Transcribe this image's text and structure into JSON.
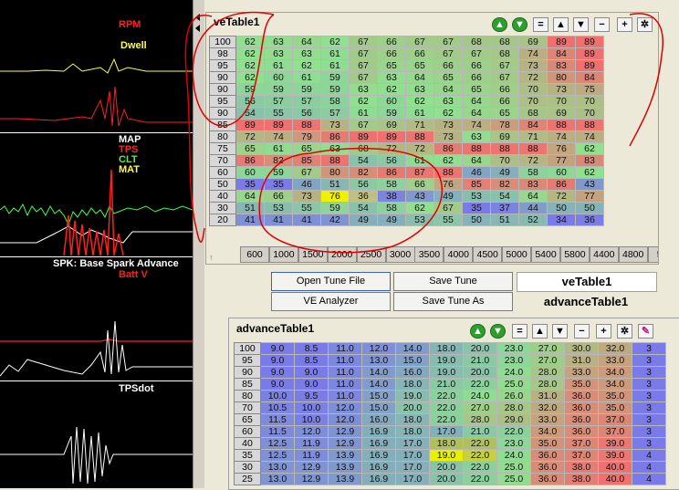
{
  "gauges": {
    "rpm": "RPM",
    "dwell": "Dwell",
    "map": "MAP",
    "tps": "TPS",
    "clt": "CLT",
    "mat": "MAT",
    "spk": "SPK: Base Spark Advance",
    "batt": "Batt V",
    "tpsdot": "TPSdot"
  },
  "colors": {
    "rpm": "#ff2020",
    "dwell": "#ffff40",
    "map": "#ffffff",
    "tps": "#ff2020",
    "clt": "#40ff40",
    "mat": "#ffff40",
    "spk": "#ffffff",
    "batt": "#ff2020",
    "tpsdot": "#ffffff",
    "cell_low": "#7a7ae8",
    "cell_mid": "#90e090",
    "cell_high": "#f07070",
    "annotation": "#e00000"
  },
  "ve": {
    "title": "veTable1",
    "rows": [
      "100",
      "98",
      "95",
      "90",
      "90",
      "95",
      "90",
      "85",
      "80",
      "75",
      "70",
      "60",
      "50",
      "40",
      "30",
      "20",
      "15"
    ],
    "cols": [
      "600",
      "1000",
      "1500",
      "2000",
      "2500",
      "3000",
      "3500",
      "4000",
      "4500",
      "5000",
      "5400",
      "5800",
      "4400",
      "4800",
      "52"
    ],
    "cells": [
      [
        62,
        63,
        64,
        62,
        67,
        66,
        67,
        67,
        68,
        68,
        69,
        89,
        89
      ],
      [
        62,
        63,
        63,
        61,
        67,
        66,
        66,
        67,
        67,
        68,
        74,
        84,
        89
      ],
      [
        62,
        61,
        62,
        61,
        67,
        65,
        65,
        66,
        66,
        67,
        73,
        83,
        89
      ],
      [
        62,
        60,
        61,
        59,
        67,
        63,
        64,
        65,
        66,
        67,
        72,
        80,
        84
      ],
      [
        59,
        59,
        59,
        59,
        63,
        62,
        63,
        64,
        65,
        66,
        70,
        73,
        75
      ],
      [
        56,
        57,
        57,
        58,
        62,
        60,
        62,
        63,
        64,
        66,
        70,
        70,
        70
      ],
      [
        54,
        55,
        56,
        57,
        61,
        59,
        61,
        62,
        64,
        65,
        68,
        69,
        70
      ],
      [
        89,
        89,
        88,
        73,
        67,
        69,
        71,
        73,
        74,
        78,
        84,
        88,
        88
      ],
      [
        72,
        74,
        79,
        86,
        89,
        89,
        88,
        73,
        63,
        69,
        71,
        74,
        74
      ],
      [
        65,
        61,
        65,
        63,
        68,
        72,
        72,
        86,
        88,
        88,
        88,
        76,
        62
      ],
      [
        86,
        82,
        85,
        88,
        54,
        56,
        61,
        62,
        64,
        70,
        72,
        77,
        83
      ],
      [
        60,
        59,
        67,
        80,
        82,
        86,
        87,
        88,
        46,
        49,
        58,
        60,
        62
      ],
      [
        35,
        35,
        46,
        51,
        56,
        58,
        66,
        76,
        85,
        82,
        83,
        86,
        43
      ],
      [
        64,
        66,
        73,
        "76",
        36,
        38,
        43,
        49,
        53,
        54,
        64,
        72,
        77
      ],
      [
        51,
        53,
        55,
        59,
        54,
        58,
        62,
        67,
        35,
        37,
        44,
        50,
        50
      ],
      [
        41,
        41,
        41,
        42,
        49,
        49,
        53,
        55,
        50,
        51,
        52,
        34,
        36
      ]
    ],
    "corner_arrow": "↑"
  },
  "buttons": {
    "open": "Open Tune File",
    "save": "Save Tune",
    "ve_analyzer": "VE Analyzer",
    "save_as": "Save Tune As",
    "name1": "veTable1",
    "name2": "advanceTable1"
  },
  "adv": {
    "title": "advanceTable1",
    "rows": [
      "100",
      "95",
      "90",
      "85",
      "80",
      "70",
      "65",
      "60",
      "40",
      "35",
      "30",
      "25",
      "20"
    ],
    "cells": [
      [
        "9.0",
        "8.5",
        "11.0",
        "12.0",
        "14.0",
        "18.0",
        "20.0",
        "23.0",
        "27.0",
        "30.0",
        "32.0",
        "3"
      ],
      [
        "9.0",
        "8.5",
        "11.0",
        "13.0",
        "15.0",
        "19.0",
        "21.0",
        "23.0",
        "27.0",
        "31.0",
        "33.0",
        "3"
      ],
      [
        "9.0",
        "9.0",
        "11.0",
        "14.0",
        "16.0",
        "19.0",
        "20.0",
        "24.0",
        "28.0",
        "33.0",
        "34.0",
        "3"
      ],
      [
        "9.0",
        "9.0",
        "11.0",
        "14.0",
        "18.0",
        "21.0",
        "22.0",
        "25.0",
        "28.0",
        "35.0",
        "34.0",
        "3"
      ],
      [
        "10.0",
        "9.5",
        "11.0",
        "15.0",
        "19.0",
        "22.0",
        "24.0",
        "26.0",
        "31.0",
        "36.0",
        "35.0",
        "3"
      ],
      [
        "10.5",
        "10.0",
        "12.0",
        "15.0",
        "20.0",
        "22.0",
        "27.0",
        "28.0",
        "32.0",
        "36.0",
        "35.0",
        "3"
      ],
      [
        "11.5",
        "10.0",
        "12.0",
        "16.0",
        "18.0",
        "22.0",
        "28.0",
        "29.0",
        "33.0",
        "36.0",
        "37.0",
        "3"
      ],
      [
        "11.5",
        "12.0",
        "12.9",
        "16.9",
        "18.0",
        "17.0",
        "21.0",
        "22.0",
        "34.0",
        "36.0",
        "37.0",
        "3"
      ],
      [
        "12.5",
        "11.9",
        "12.9",
        "16.9",
        "17.0",
        "18.0",
        "22.0",
        "23.0",
        "35.0",
        "37.0",
        "39.0",
        "3"
      ],
      [
        "12.5",
        "11.9",
        "13.9",
        "16.9",
        "17.0",
        "19.0",
        "22.0",
        "24.0",
        "36.0",
        "37.0",
        "39.0",
        "4"
      ],
      [
        "13.0",
        "12.9",
        "13.9",
        "16.9",
        "17.0",
        "20.0",
        "22.0",
        "25.0",
        "36.0",
        "38.0",
        "40.0",
        "4"
      ],
      [
        "13.0",
        "12.9",
        "13.9",
        "16.9",
        "17.0",
        "20.0",
        "22.0",
        "25.0",
        "36.0",
        "38.0",
        "40.0",
        "4"
      ]
    ]
  }
}
